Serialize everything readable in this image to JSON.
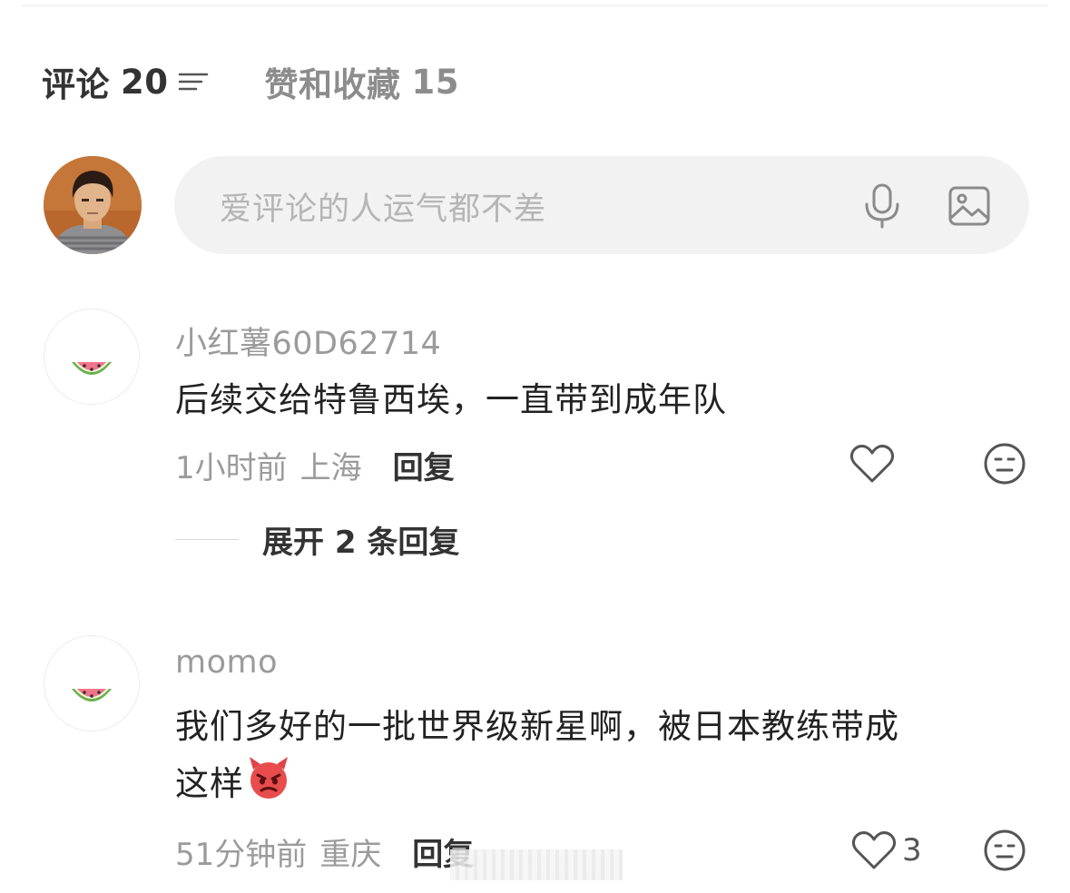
{
  "tabs": {
    "comments_label": "评论",
    "comments_count": "20",
    "likes_label": "赞和收藏",
    "likes_count": "15"
  },
  "composer": {
    "placeholder": "爱评论的人运气都不差"
  },
  "icons": {
    "sort": "sort-lines-icon",
    "mic": "microphone-icon",
    "image": "image-icon",
    "like": "heart-icon",
    "emoji": "emoji-face-icon",
    "avatar_default": "watermelon-icon"
  },
  "colors": {
    "primary_text": "#333333",
    "secondary_text": "#9b9b9b",
    "input_bg": "#f2f2f2",
    "placeholder": "#b5b5b5"
  },
  "comments": [
    {
      "author": "小红薯60D62714",
      "text": "后续交给特鲁西埃，一直带到成年队",
      "time": "1小时前",
      "location": "上海",
      "reply_label": "回复",
      "likes": "",
      "expand_label": "展开 2 条回复"
    },
    {
      "author": "momo",
      "text_line1": "我们多好的一批世界级新星啊，被日本教练带成",
      "text_line2": "这样",
      "emoji": "angry-devil-emoji",
      "time": "51分钟前",
      "location": "重庆",
      "reply_label": "回复",
      "likes": "3"
    }
  ]
}
